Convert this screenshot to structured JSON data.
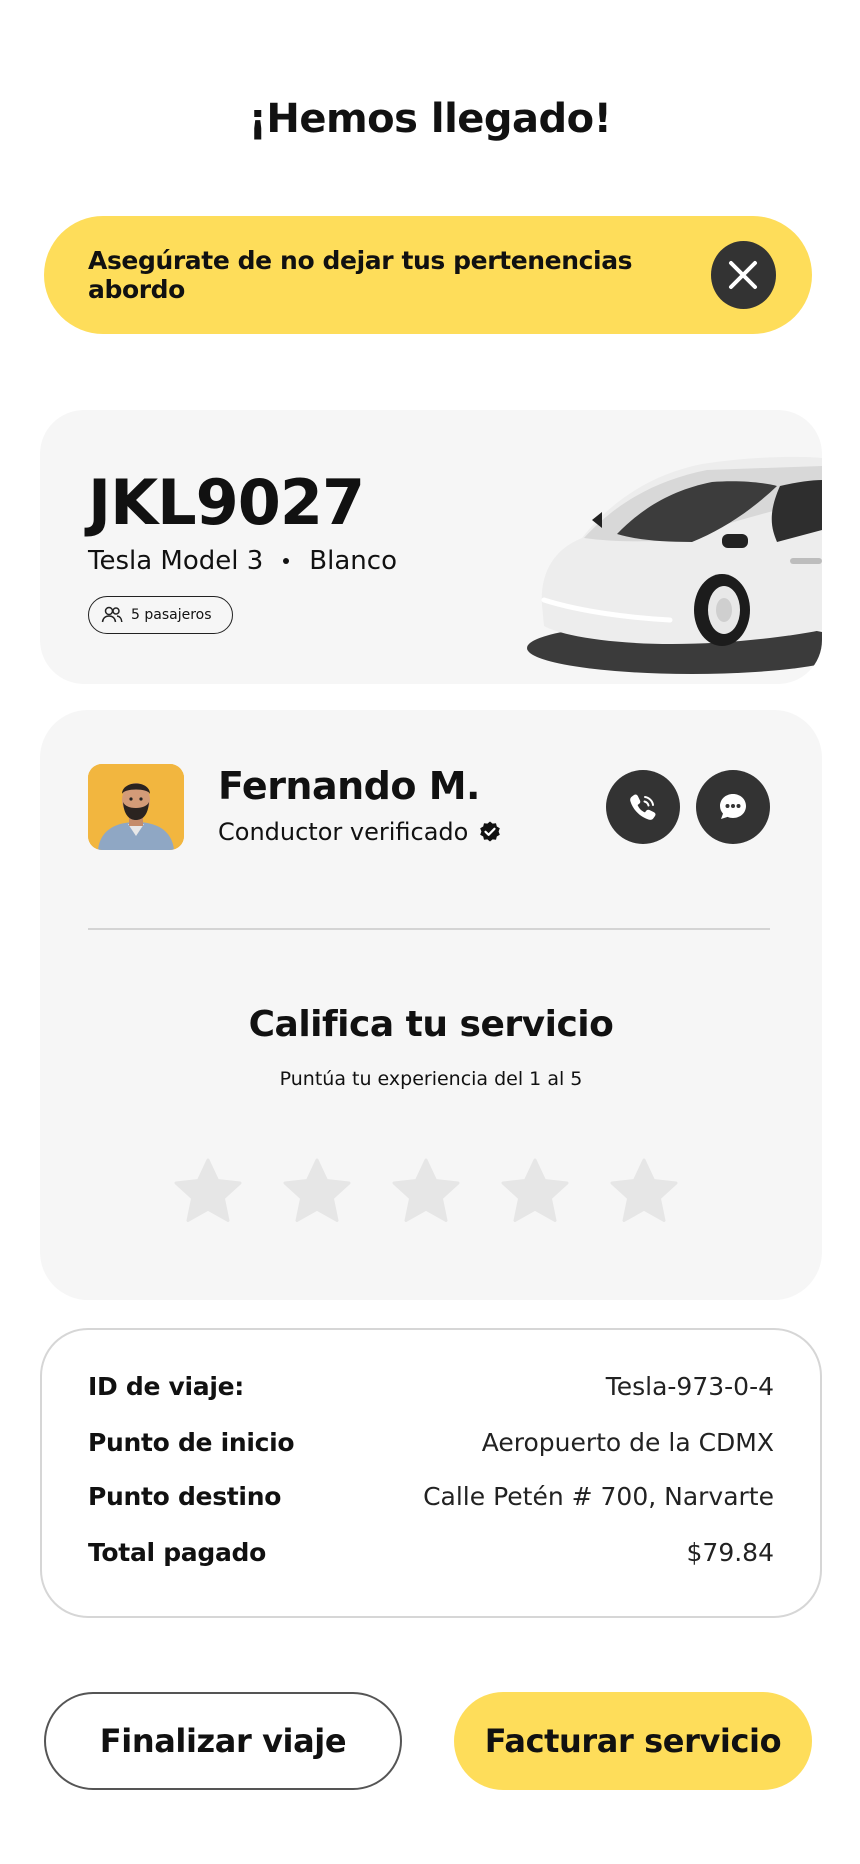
{
  "header": {
    "title": "¡Hemos llegado!"
  },
  "banner": {
    "text": "Asegúrate de no dejar tus pertenencias abordo",
    "close_icon": "close-icon"
  },
  "vehicle": {
    "plate": "JKL9027",
    "model": "Tesla Model 3",
    "color": "Blanco",
    "passengers": "5 pasajeros"
  },
  "driver": {
    "name": "Fernando M.",
    "status": "Conductor verificado",
    "call_icon": "phone-icon",
    "chat_icon": "chat-icon"
  },
  "rating": {
    "title": "Califica tu servicio",
    "subtitle": "Puntúa tu experiencia del 1 al 5",
    "max": 5,
    "value": 0
  },
  "trip": {
    "rows": [
      {
        "label": "ID de viaje:",
        "value": "Tesla-973-0-4"
      },
      {
        "label": "Punto de inicio",
        "value": "Aeropuerto de la CDMX"
      },
      {
        "label": "Punto destino",
        "value": "Calle Petén # 700, Narvarte"
      },
      {
        "label": "Total pagado",
        "value": "$79.84"
      }
    ]
  },
  "actions": {
    "finish_label": "Finalizar viaje",
    "invoice_label": "Facturar servicio"
  },
  "colors": {
    "accent": "#FEDD5A",
    "dark": "#333333",
    "card": "#F6F6F6",
    "star": "#E6E6E6"
  }
}
